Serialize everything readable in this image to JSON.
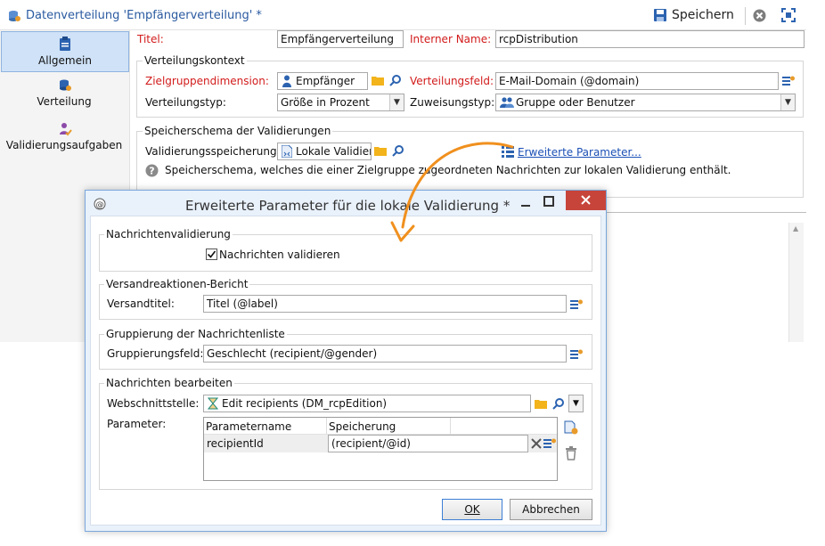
{
  "window": {
    "title": "Datenverteilung 'Empfängerverteilung' *",
    "save_label": "Speichern"
  },
  "sidebar": {
    "items": [
      {
        "label": "Allgemein",
        "icon": "clipboard-icon"
      },
      {
        "label": "Verteilung",
        "icon": "database-user-icon"
      },
      {
        "label": "Validierungsaufgaben",
        "icon": "user-check-icon"
      }
    ]
  },
  "general": {
    "title_label": "Titel:",
    "title_value": "Empfängerverteilung",
    "internal_name_label": "Interner Name:",
    "internal_name_value": "rcpDistribution"
  },
  "context": {
    "legend": "Verteilungskontext",
    "target_dim_label": "Zielgruppendimension:",
    "target_dim_value": "Empfänger",
    "distribution_field_label": "Verteilungsfeld:",
    "distribution_field_value": "E-Mail-Domain (@domain)",
    "distribution_type_label": "Verteilungstyp:",
    "distribution_type_value": "Größe in Prozent",
    "assignment_type_label": "Zuweisungstyp:",
    "assignment_type_value": "Gruppe oder Benutzer"
  },
  "storage": {
    "legend": "Speicherschema der Validierungen",
    "storage_label": "Validierungsspeicherung:",
    "storage_value": "Lokale Validier",
    "advanced_link": "Erweiterte Parameter...",
    "help_text": "Speicherschema, welches die einer Zielgruppe zugeordneten Nachrichten zur lokalen Validierung enthält."
  },
  "dialog": {
    "title": "Erweiterte Parameter für die lokale Validierung *",
    "msg_validation": {
      "legend": "Nachrichtenvalidierung",
      "checkbox_label": "Nachrichten validieren",
      "checked": true
    },
    "delivery_report": {
      "legend": "Versandreaktionen-Bericht",
      "field_label": "Versandtitel:",
      "field_value": "Titel (@label)"
    },
    "grouping": {
      "legend": "Gruppierung der Nachrichtenliste",
      "field_label": "Gruppierungsfeld:",
      "field_value": "Geschlecht (recipient/@gender)"
    },
    "edit_messages": {
      "legend": "Nachrichten bearbeiten",
      "webapp_label": "Webschnittstelle:",
      "webapp_value": "Edit recipients (DM_rcpEdition)",
      "params_label": "Parameter:",
      "columns": [
        "Parametername",
        "Speicherung"
      ],
      "rows": [
        {
          "name": "recipientId",
          "storage": "(recipient/@id)"
        }
      ]
    },
    "ok_label": "OK",
    "cancel_label": "Abbrechen"
  },
  "colors": {
    "accent_orange": "#f0901e",
    "selected_blue": "#cfe2f7",
    "required_red": "#d21b1b",
    "dialog_frame": "#7aa7db"
  }
}
